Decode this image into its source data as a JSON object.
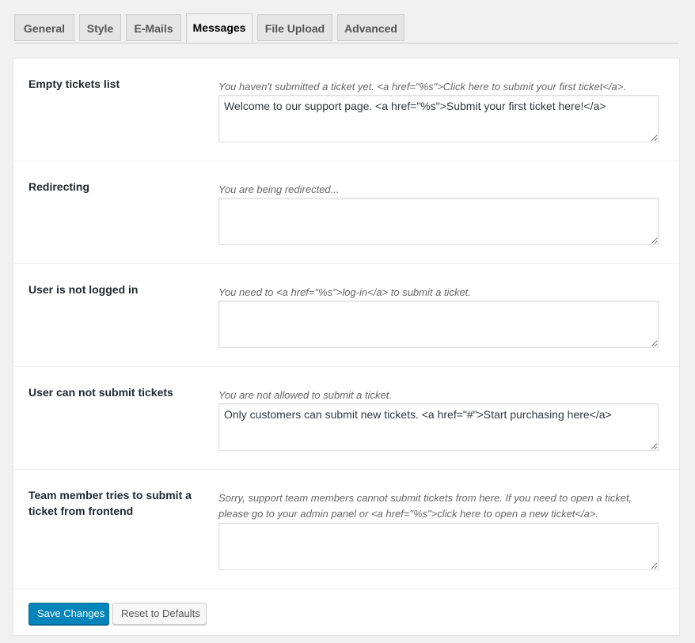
{
  "tabs": [
    {
      "label": "General"
    },
    {
      "label": "Style"
    },
    {
      "label": "E-Mails"
    },
    {
      "label": "Messages"
    },
    {
      "label": "File Upload"
    },
    {
      "label": "Advanced"
    }
  ],
  "active_tab": "Messages",
  "settings": [
    {
      "label": "Empty tickets list",
      "description": "You haven't submitted a ticket yet. <a href=\"%s\">Click here to submit your first ticket</a>.",
      "value": "Welcome to our support page. <a href=\"%s\">Submit your first ticket here!</a>"
    },
    {
      "label": "Redirecting",
      "description": "You are being redirected...",
      "value": ""
    },
    {
      "label": "User is not logged in",
      "description": "You need to <a href=\"%s\">log-in</a> to submit a ticket.",
      "value": ""
    },
    {
      "label": "User can not submit tickets",
      "description": "You are not allowed to submit a ticket.",
      "value": "Only customers can submit new tickets. <a href=\"#\">Start purchasing here</a>"
    },
    {
      "label": "Team member tries to submit a ticket from frontend",
      "description": "Sorry, support team members cannot submit tickets from here. If you need to open a ticket, please go to your admin panel or <a href=\"%s\">click here to open a new ticket</a>.",
      "value": ""
    }
  ],
  "buttons": {
    "save": "Save Changes",
    "reset": "Reset to Defaults"
  },
  "colors": {
    "primary_button": "#0085ba",
    "page_background": "#f1f1f1",
    "panel_background": "#ffffff"
  }
}
